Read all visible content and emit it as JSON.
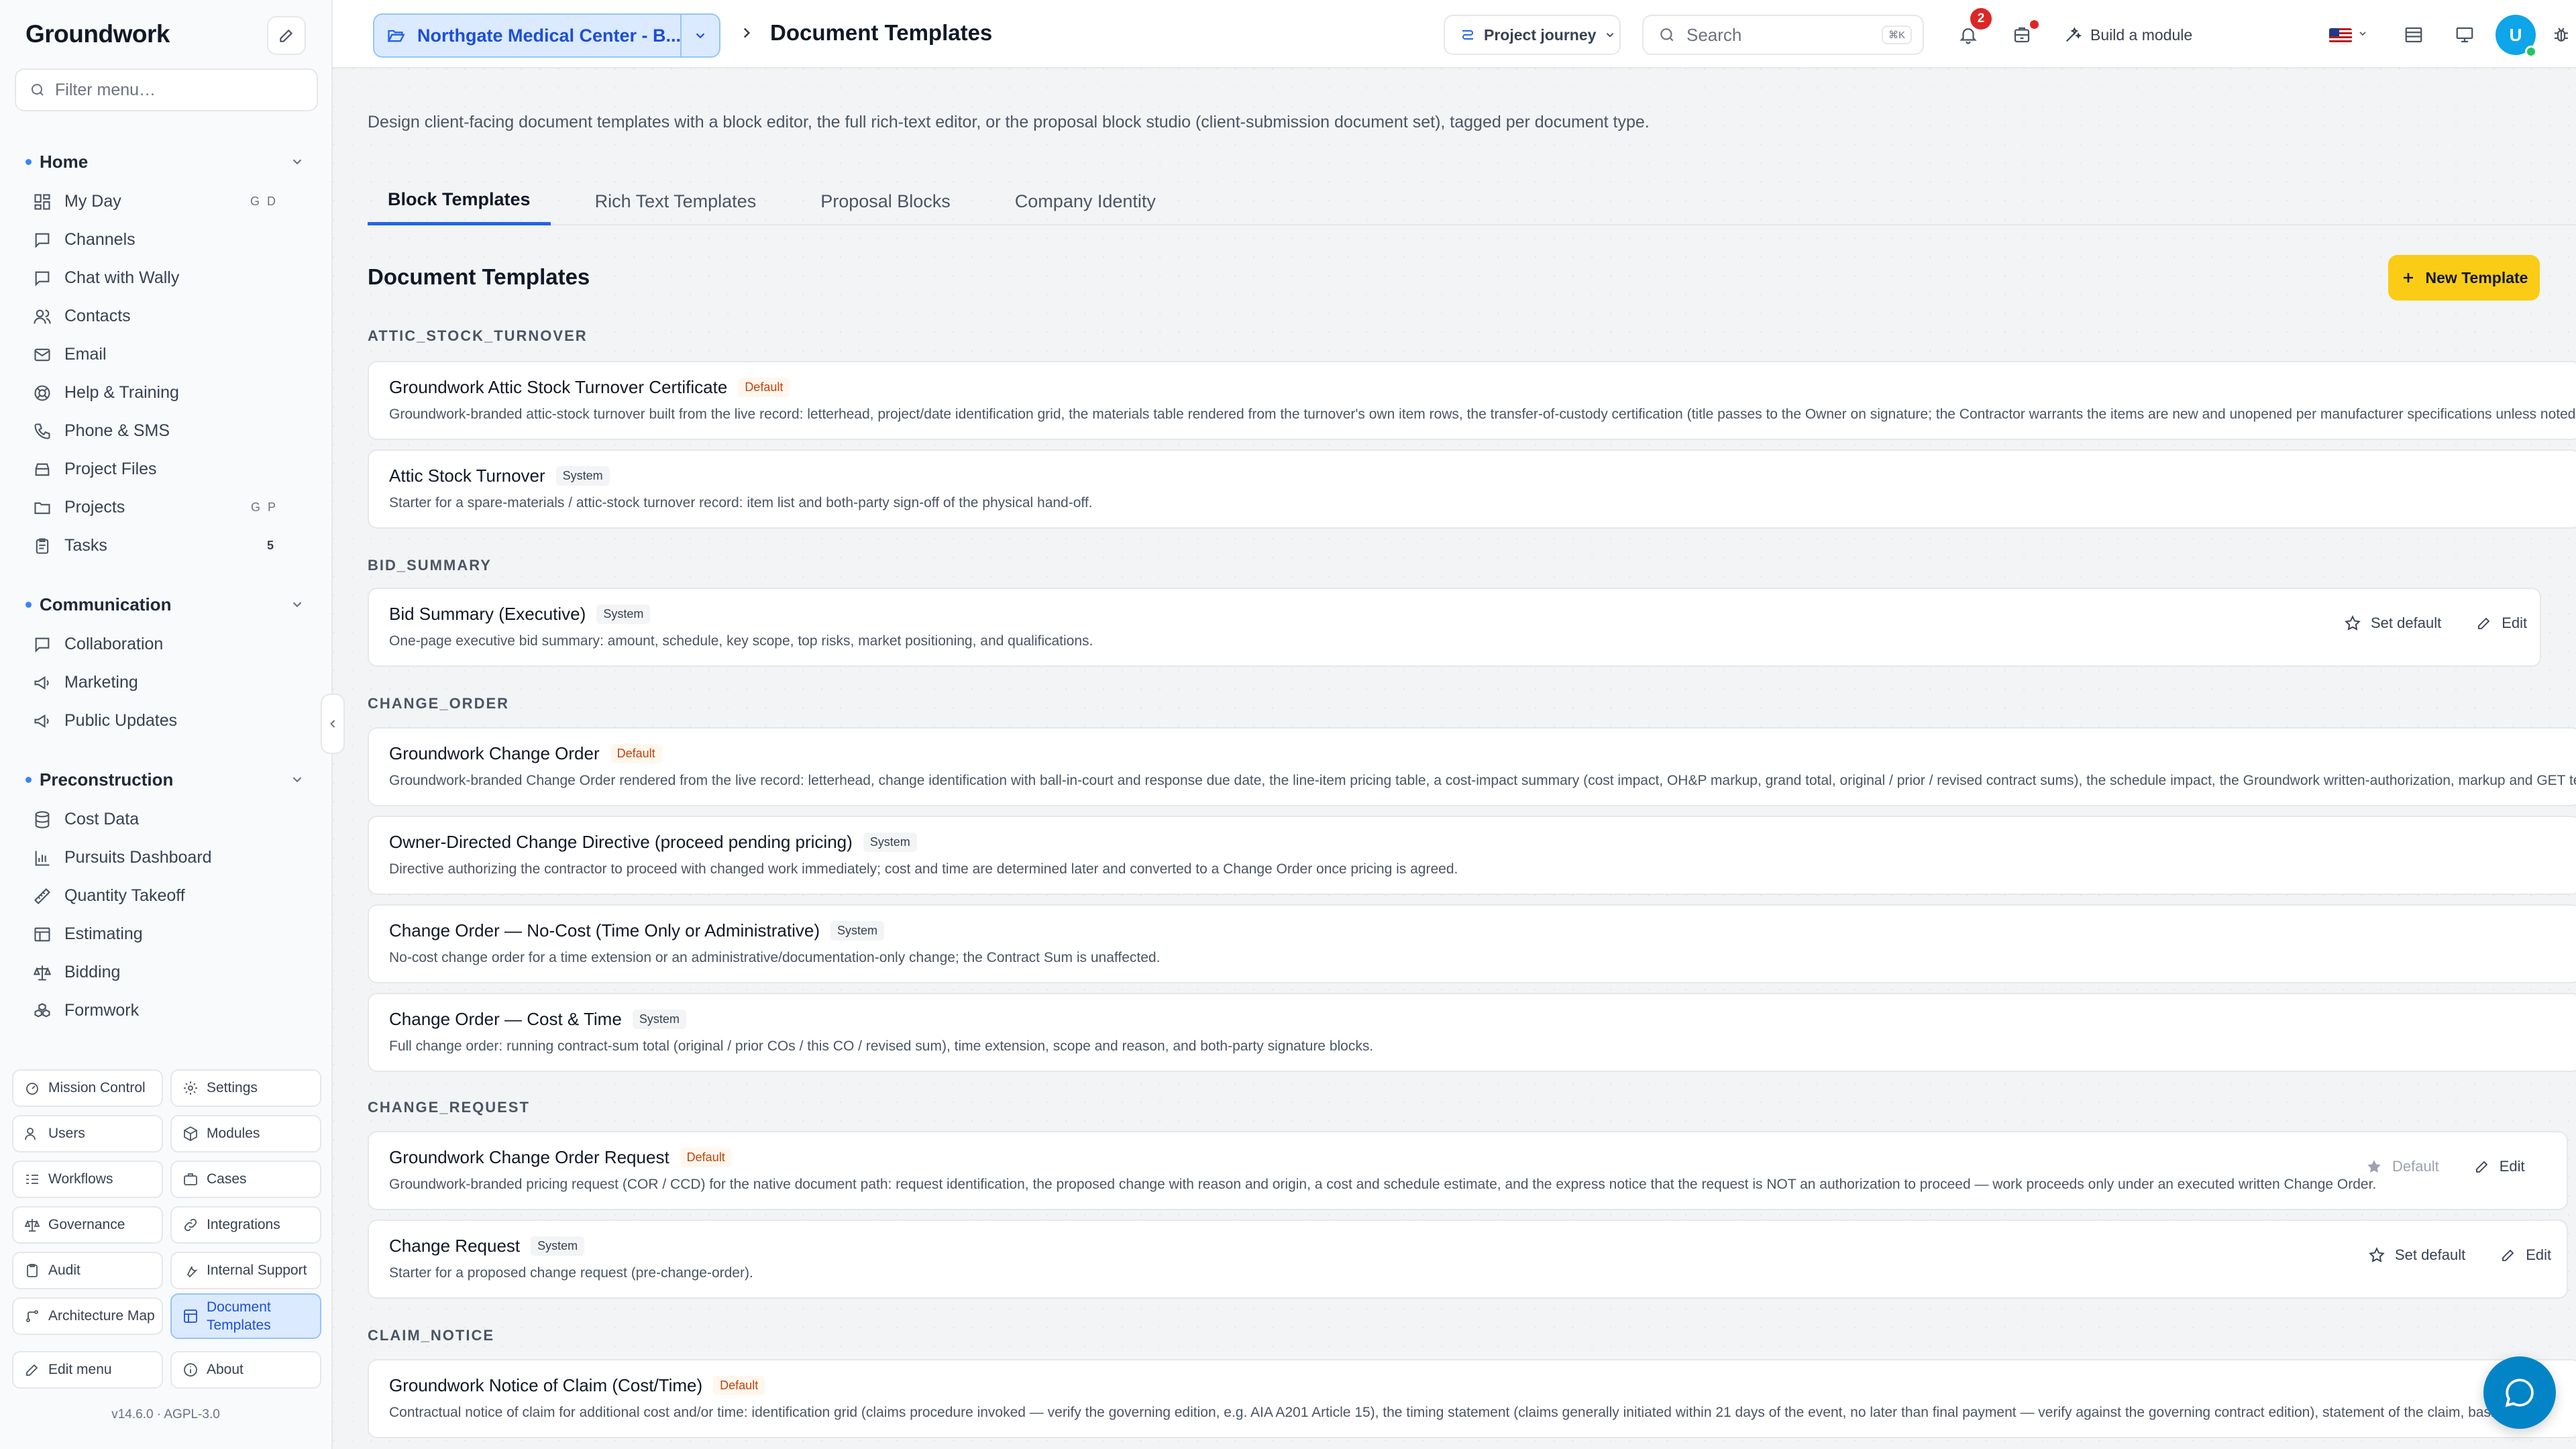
{
  "sidebar": {
    "brand": "Groundwork",
    "filter_placeholder": "Filter menu…",
    "sections": [
      {
        "title": "Home",
        "items": [
          {
            "label": "My Day",
            "hint": "G D",
            "icon": "grid-icon"
          },
          {
            "label": "Channels",
            "icon": "chat-bubble-icon"
          },
          {
            "label": "Chat with Wally",
            "icon": "chat-bubble-icon"
          },
          {
            "label": "Contacts",
            "icon": "users-icon"
          },
          {
            "label": "Email",
            "icon": "mail-icon"
          },
          {
            "label": "Help & Training",
            "icon": "lifebuoy-icon"
          },
          {
            "label": "Phone & SMS",
            "icon": "phone-icon"
          },
          {
            "label": "Project Files",
            "icon": "archive-icon"
          },
          {
            "label": "Projects",
            "hint": "G P",
            "icon": "folder-icon"
          },
          {
            "label": "Tasks",
            "count": "5",
            "icon": "clipboard-icon"
          }
        ]
      },
      {
        "title": "Communication",
        "items": [
          {
            "label": "Collaboration",
            "icon": "chat-bubble-icon"
          },
          {
            "label": "Marketing",
            "icon": "megaphone-icon"
          },
          {
            "label": "Public Updates",
            "icon": "megaphone-icon"
          }
        ]
      },
      {
        "title": "Preconstruction",
        "items": [
          {
            "label": "Cost Data",
            "icon": "database-icon"
          },
          {
            "label": "Pursuits Dashboard",
            "icon": "bar-chart-icon"
          },
          {
            "label": "Quantity Takeoff",
            "icon": "ruler-icon"
          },
          {
            "label": "Estimating",
            "icon": "table-icon"
          },
          {
            "label": "Bidding",
            "icon": "scale-icon"
          },
          {
            "label": "Formwork",
            "icon": "boxes-icon"
          }
        ]
      }
    ],
    "tools": [
      {
        "label": "Mission Control",
        "icon": "gauge-icon"
      },
      {
        "label": "Settings",
        "icon": "gear-icon"
      },
      {
        "label": "Users",
        "icon": "users-icon"
      },
      {
        "label": "Modules",
        "icon": "cube-icon"
      },
      {
        "label": "Workflows",
        "icon": "workflow-icon"
      },
      {
        "label": "Cases",
        "icon": "briefcase-icon"
      },
      {
        "label": "Governance",
        "icon": "scale-icon"
      },
      {
        "label": "Integrations",
        "icon": "link-icon"
      },
      {
        "label": "Audit",
        "icon": "clipboard-icon"
      },
      {
        "label": "Internal Support",
        "icon": "wrench-icon"
      },
      {
        "label": "Architecture Map",
        "icon": "map-icon"
      },
      {
        "label": "Document Templates",
        "icon": "layout-icon"
      },
      {
        "label": "Edit menu",
        "icon": "pencil-icon"
      },
      {
        "label": "About",
        "icon": "info-icon"
      }
    ],
    "version": "v14.6.0  ·  AGPL-3.0"
  },
  "topbar": {
    "project_name": "Northgate Medical Center - B...",
    "page_title": "Document Templates",
    "journey_label": "Project journey",
    "search_placeholder": "Search",
    "search_shortcut": "⌘K",
    "notification_count": "2",
    "build_label": "Build a module",
    "avatar_initial": "U"
  },
  "main": {
    "intro": "Design client-facing document templates with a block editor, the full rich-text editor, or the proposal block studio (client-submission document set), tagged per document type.",
    "tabs": [
      "Block Templates",
      "Rich Text Templates",
      "Proposal Blocks",
      "Company Identity"
    ],
    "section_title": "Document Templates",
    "new_button": "New Template",
    "groups": [
      {
        "label": "ATTIC_STOCK_TURNOVER",
        "cards": [
          {
            "name": "Groundwork Attic Stock Turnover Certificate",
            "tag": "Default",
            "desc": "Groundwork-branded attic-stock turnover built from the live record: letterhead, project/date identification grid, the materials table rendered from the turnover's own item rows, the transfer-of-custody certification (title passes to the Owner on signature; the Contractor warrants the items are new and unopened per manufacturer specifications unless noted), dual co"
          },
          {
            "name": "Attic Stock Turnover",
            "tag": "System",
            "desc": "Starter for a spare-materials / attic-stock turnover record: item list and both-party sign-off of the physical hand-off."
          }
        ]
      },
      {
        "label": "BID_SUMMARY",
        "cards": [
          {
            "name": "Bid Summary (Executive)",
            "tag": "System",
            "desc": "One-page executive bid summary: amount, schedule, key scope, top risks, market positioning, and qualifications.",
            "set_default": "Set default",
            "edit": "Edit"
          }
        ]
      },
      {
        "label": "CHANGE_ORDER",
        "cards": [
          {
            "name": "Groundwork Change Order",
            "tag": "Default",
            "desc": "Groundwork-branded Change Order rendered from the live record: letterhead, change identification with ball-in-court and response due date, the line-item pricing table, a cost-impact summary (cost impact, OH&P markup, grand total, original / prior / revised contract sums), the schedule impact, the Groundwork written-authorization, markup and GET terms, an"
          },
          {
            "name": "Owner-Directed Change Directive (proceed pending pricing)",
            "tag": "System",
            "desc": "Directive authorizing the contractor to proceed with changed work immediately; cost and time are determined later and converted to a Change Order once pricing is agreed."
          },
          {
            "name": "Change Order — No-Cost (Time Only or Administrative)",
            "tag": "System",
            "desc": "No-cost change order for a time extension or an administrative/documentation-only change; the Contract Sum is unaffected."
          },
          {
            "name": "Change Order — Cost & Time",
            "tag": "System",
            "desc": "Full change order: running contract-sum total (original / prior COs / this CO / revised sum), time extension, scope and reason, and both-party signature blocks."
          }
        ]
      },
      {
        "label": "CHANGE_REQUEST",
        "cards": [
          {
            "name": "Groundwork Change Order Request",
            "tag": "Default",
            "desc": "Groundwork-branded pricing request (COR / CCD) for the native document path: request identification, the proposed change with reason and origin, a cost and schedule estimate, and the express notice that the request is NOT an authorization to proceed — work proceeds only under an executed written Change Order.",
            "set_default": "Default",
            "edit": "Edit"
          },
          {
            "name": "Change Request",
            "tag": "System",
            "desc": "Starter for a proposed change request (pre-change-order).",
            "set_default": "Set default",
            "edit": "Edit"
          }
        ]
      },
      {
        "label": "CLAIM_NOTICE",
        "cards": [
          {
            "name": "Groundwork Notice of Claim (Cost/Time)",
            "tag": "Default",
            "desc": "Contractual notice of claim for additional cost and/or time: identification grid (claims procedure invoked — verify the governing edition, e.g. AIA A201 Article 15), the timing statement (claims generally initiated within 21 days of the event, no later than final payment — verify against the governing contract edition), statement of the claim, basis check"
          }
        ]
      }
    ]
  }
}
